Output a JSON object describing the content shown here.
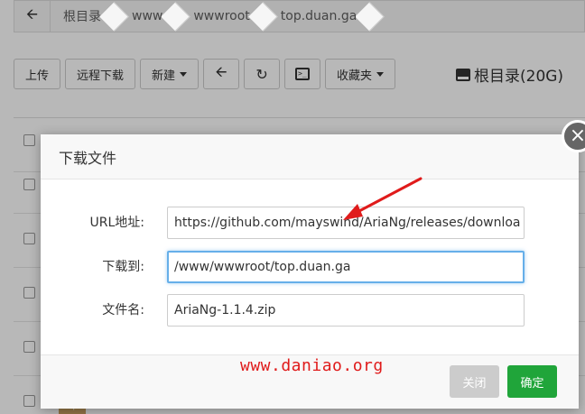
{
  "breadcrumb": {
    "back_icon": "arrow-left-icon",
    "items": [
      "根目录",
      "www",
      "wwwroot",
      "top.duan.ga"
    ]
  },
  "toolbar": {
    "upload": "上传",
    "remote_download": "远程下载",
    "new": "新建",
    "back_icon": "arrow-left-icon",
    "refresh_icon": "refresh-icon",
    "terminal_icon": "terminal-icon",
    "favorites": "收藏夹"
  },
  "disk": {
    "label": "根目录(20G)",
    "icon": "hdd-icon"
  },
  "table": {
    "file_badge": "zip"
  },
  "modal": {
    "title": "下载文件",
    "url_label": "URL地址:",
    "url_value": "https://github.com/mayswind/AriaNg/releases/downloa",
    "dest_label": "下载到:",
    "dest_value": "/www/wwwroot/top.duan.ga",
    "filename_label": "文件名:",
    "filename_value": "AriaNg-1.1.4.zip",
    "close_button": "关闭",
    "confirm_button": "确定",
    "close_icon": "close-icon"
  },
  "watermark": "www.daniao.org",
  "colors": {
    "confirm": "#20a53a",
    "watermark": "#e01b1b",
    "arrow": "#e01b1b",
    "focus_border": "#66afe9"
  }
}
